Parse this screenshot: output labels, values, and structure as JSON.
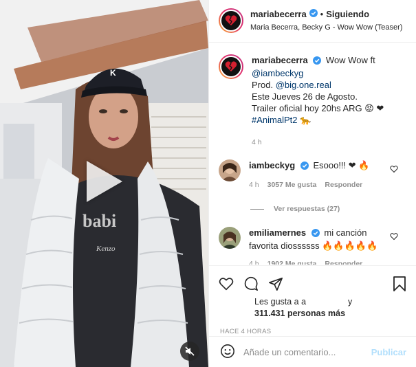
{
  "post": {
    "username": "mariabecerra",
    "dot": "•",
    "follow_status": "Siguiendo",
    "subtitle": "Maria Becerra, Becky G - Wow Wow (Teaser)"
  },
  "caption": {
    "username": "mariabecerra",
    "text_1": "Wow Wow ft",
    "mention_1": "@iambeckyg",
    "prod": "Prod.",
    "mention_2": "@big.one.real",
    "line_3": "Este Jueves 26 de Agosto.",
    "line_4": "Trailer oficial hoy 20hs ARG 😡 ❤",
    "hashtag": "#AnimalPt2 🐆",
    "time": "4 h"
  },
  "comments": [
    {
      "username": "iambeckyg",
      "text": "Esooo!!! ❤ 🔥",
      "time": "4 h",
      "likes": "3057 Me gusta",
      "reply": "Responder"
    },
    {
      "username": "emiliamernes",
      "text": "mi canción favorita diossssss 🔥🔥🔥🔥🔥",
      "time": "4 h",
      "likes": "1902 Me gusta",
      "reply": "Responder"
    }
  ],
  "view_replies": "Ver respuestas (27)",
  "likes": {
    "prefix": "Les gusta a a",
    "suffix": "y",
    "count": "311.431 personas más"
  },
  "posted_ago": "HACE 4 HORAS",
  "add_comment": {
    "placeholder": "Añade un comentario...",
    "publish": "Publicar"
  },
  "colors": {
    "verified": "#3897f0",
    "link": "#00376b",
    "muted": "#8e8e8e",
    "publish_disabled": "#b2dffc"
  },
  "icons": [
    "play-icon",
    "mute-icon",
    "verified-icon",
    "heart-icon",
    "comment-icon",
    "share-icon",
    "save-icon",
    "emoji-icon"
  ]
}
